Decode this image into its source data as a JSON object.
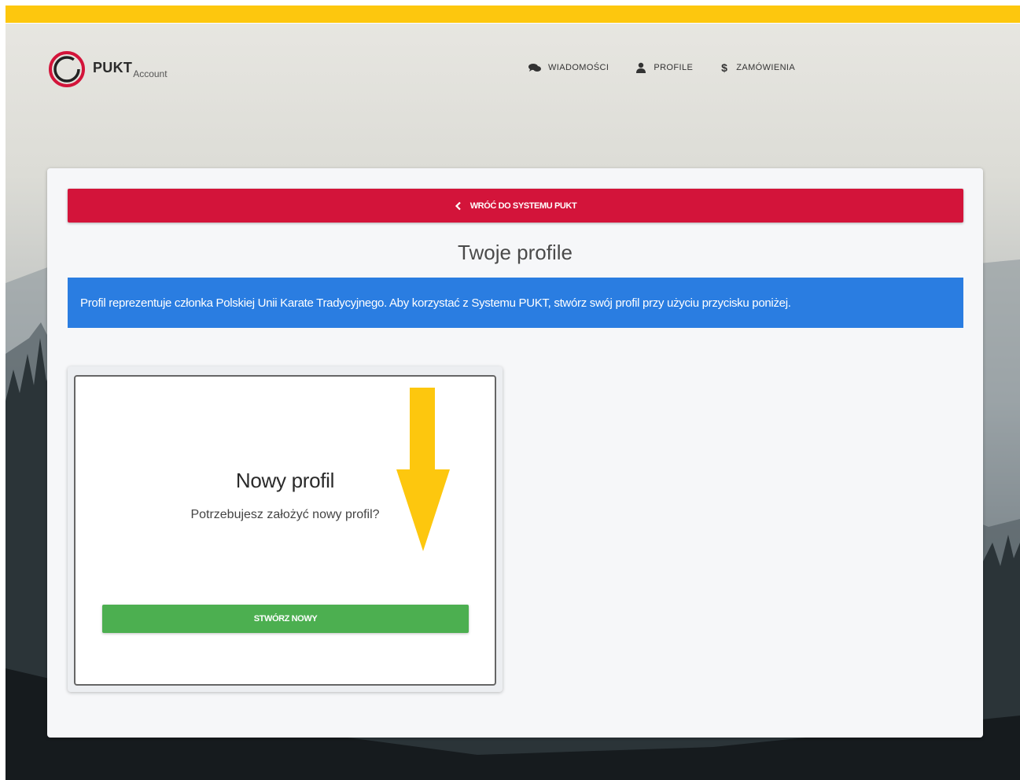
{
  "brand": {
    "name": "PUKT",
    "sub": "Account"
  },
  "nav": [
    {
      "label": "WIADOMOŚCI",
      "icon": "chat-icon"
    },
    {
      "label": "PROFILE",
      "icon": "user-icon"
    },
    {
      "label": "ZAMÓWIENIA",
      "icon": "dollar-icon",
      "glyph": "$"
    }
  ],
  "main": {
    "back_label": "WRÓĆ DO SYSTEMU PUKT",
    "title": "Twoje profile",
    "info": "Profil reprezentuje członka Polskiej Unii Karate Tradycyjnego. Aby korzystać z Systemu PUKT, stwórz swój profil przy użyciu przycisku poniżej."
  },
  "new_profile": {
    "title": "Nowy profil",
    "subtitle": "Potrzebujesz założyć nowy profil?",
    "button": "STWÓRZ NOWY"
  },
  "colors": {
    "accent_bar": "#fdc70e",
    "back_button": "#d3143a",
    "info_banner": "#2a7de1",
    "create_button": "#4caf50",
    "arrow": "#fdc70e"
  }
}
